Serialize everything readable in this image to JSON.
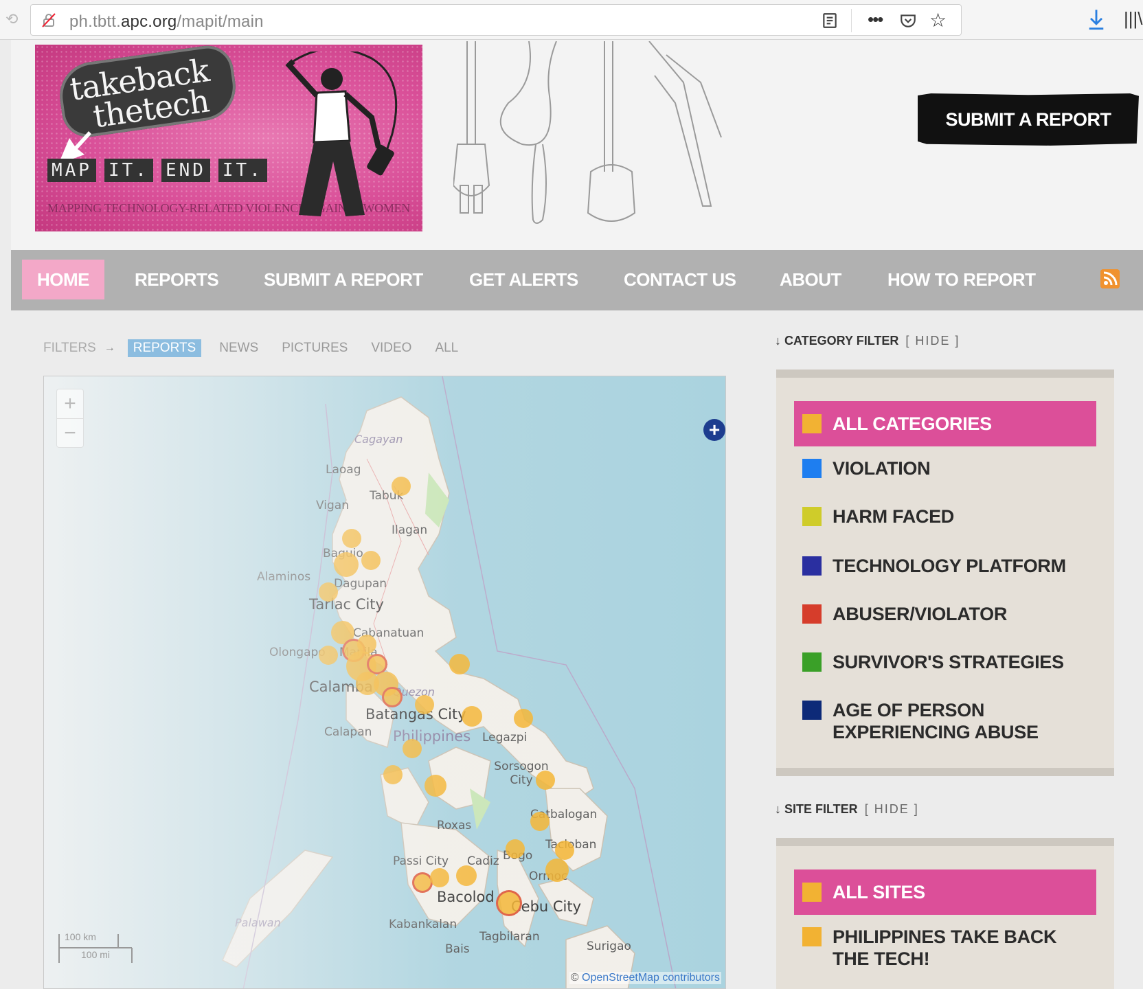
{
  "browser": {
    "url_prefix": "ph.tbtt.",
    "url_domain": "apc.org",
    "url_path": "/mapit/main"
  },
  "header": {
    "logo": {
      "take": "takeback",
      "tech": "thetech",
      "tagline": [
        "MAP",
        "IT.",
        "END",
        "IT."
      ],
      "subtitle": "Mapping technology-related violence against women"
    },
    "submit_button": "SUBMIT A REPORT"
  },
  "nav": {
    "items": [
      "HOME",
      "REPORTS",
      "SUBMIT A REPORT",
      "GET ALERTS",
      "CONTACT US",
      "ABOUT",
      "HOW TO REPORT"
    ],
    "active": "HOME"
  },
  "filters": {
    "label": "FILTERS",
    "tabs": [
      "REPORTS",
      "NEWS",
      "PICTURES",
      "VIDEO",
      "ALL"
    ],
    "active": "REPORTS"
  },
  "map": {
    "zoom_in": "+",
    "zoom_out": "−",
    "layers": "+",
    "scale_km": "100 km",
    "scale_mi": "100 mi",
    "attribution_prefix": "© ",
    "attribution_link": "OpenStreetMap",
    "attribution_suffix": " contributors",
    "labels": {
      "cagayan": "Cagayan",
      "laoag": "Laoag",
      "tabuk": "Tabuk",
      "vigan": "Vigan",
      "ilagan": "Ilagan",
      "baguio": "Baguio",
      "alaminos": "Alaminos",
      "dagupan": "Dagupan",
      "tarlac": "Tarlac City",
      "cabanatuan": "Cabanatuan",
      "olongapo": "Olongapo",
      "manila": "Manila",
      "calamba": "Calamba",
      "quezon": "Quezon",
      "batangas": "Batangas City",
      "calapan": "Calapan",
      "philippines": "Philippines",
      "legazpi": "Legazpi",
      "sorsogon": "Sorsogon City",
      "catbalogan": "Catbalogan",
      "tacloban": "Tacloban",
      "roxas": "Roxas",
      "passi": "Passi City",
      "cadiz": "Cadiz",
      "bogo": "Bogo",
      "ormoc": "Ormoc",
      "bacolod": "Bacolod",
      "cebu": "Cebu City",
      "palawan": "Palawan",
      "kabankalan": "Kabankalan",
      "tagbilaran": "Tagbilaran",
      "bais": "Bais",
      "surigao": "Surigao"
    }
  },
  "category_filter": {
    "heading": "CATEGORY FILTER",
    "hide": "[ HIDE ]",
    "items": [
      {
        "label": "ALL CATEGORIES",
        "color": "#f2b233"
      },
      {
        "label": "VIOLATION",
        "color": "#1e7ef0"
      },
      {
        "label": "HARM FACED",
        "color": "#cfcc2a"
      },
      {
        "label": "TECHNOLOGY PLATFORM",
        "color": "#2a2fa0"
      },
      {
        "label": "ABUSER/VIOLATOR",
        "color": "#d63d2b"
      },
      {
        "label": "SURVIVOR'S STRATEGIES",
        "color": "#3aa028"
      },
      {
        "label": "AGE OF PERSON EXPERIENCING ABUSE",
        "color": "#0d2a78"
      }
    ]
  },
  "site_filter": {
    "heading": "SITE FILTER",
    "hide": "[ HIDE ]",
    "items": [
      {
        "label": "ALL SITES",
        "color": "#f2b233"
      },
      {
        "label": "PHILIPPINES TAKE BACK THE TECH!",
        "color": "#f2b233"
      }
    ]
  },
  "colors": {
    "accent_pink": "#dc4f99",
    "marker": "#f5b229",
    "nav_bg": "#b1b1b1"
  }
}
